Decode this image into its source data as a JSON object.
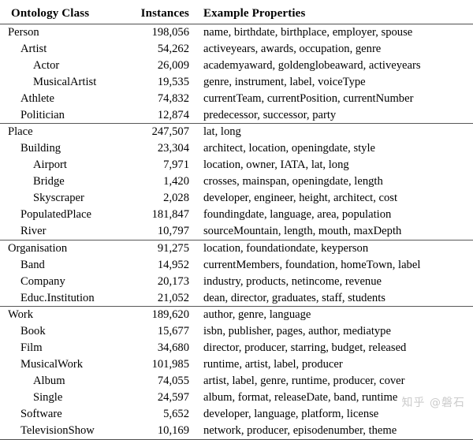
{
  "table": {
    "columns": [
      {
        "key": "ontology_class",
        "header": "Ontology Class",
        "align": "left"
      },
      {
        "key": "instances",
        "header": "Instances",
        "align": "right"
      },
      {
        "key": "example_properties",
        "header": "Example Properties",
        "align": "left"
      }
    ],
    "groups": [
      {
        "name": "Person",
        "rows": [
          {
            "level": 0,
            "ontology_class": "Person",
            "instances": "198,056",
            "example_properties": "name, birthdate, birthplace, employer, spouse"
          },
          {
            "level": 1,
            "ontology_class": "Artist",
            "instances": "54,262",
            "example_properties": "activeyears, awards, occupation, genre"
          },
          {
            "level": 2,
            "ontology_class": "Actor",
            "instances": "26,009",
            "example_properties": "academyaward, goldenglobeaward, activeyears"
          },
          {
            "level": 2,
            "ontology_class": "MusicalArtist",
            "instances": "19,535",
            "example_properties": "genre, instrument, label, voiceType"
          },
          {
            "level": 1,
            "ontology_class": "Athlete",
            "instances": "74,832",
            "example_properties": "currentTeam, currentPosition, currentNumber"
          },
          {
            "level": 1,
            "ontology_class": "Politician",
            "instances": "12,874",
            "example_properties": "predecessor, successor, party"
          }
        ]
      },
      {
        "name": "Place",
        "rows": [
          {
            "level": 0,
            "ontology_class": "Place",
            "instances": "247,507",
            "example_properties": "lat, long"
          },
          {
            "level": 1,
            "ontology_class": "Building",
            "instances": "23,304",
            "example_properties": "architect, location, openingdate, style"
          },
          {
            "level": 2,
            "ontology_class": "Airport",
            "instances": "7,971",
            "example_properties": "location, owner, IATA, lat, long"
          },
          {
            "level": 2,
            "ontology_class": "Bridge",
            "instances": "1,420",
            "example_properties": "crosses, mainspan, openingdate, length"
          },
          {
            "level": 2,
            "ontology_class": "Skyscraper",
            "instances": "2,028",
            "example_properties": "developer, engineer, height, architect, cost"
          },
          {
            "level": 1,
            "ontology_class": "PopulatedPlace",
            "instances": "181,847",
            "example_properties": "foundingdate, language, area, population"
          },
          {
            "level": 1,
            "ontology_class": "River",
            "instances": "10,797",
            "example_properties": "sourceMountain, length, mouth, maxDepth"
          }
        ]
      },
      {
        "name": "Organisation",
        "rows": [
          {
            "level": 0,
            "ontology_class": "Organisation",
            "instances": "91,275",
            "example_properties": "location, foundationdate, keyperson"
          },
          {
            "level": 1,
            "ontology_class": "Band",
            "instances": "14,952",
            "example_properties": "currentMembers, foundation, homeTown, label"
          },
          {
            "level": 1,
            "ontology_class": "Company",
            "instances": "20,173",
            "example_properties": "industry, products, netincome, revenue"
          },
          {
            "level": 1,
            "ontology_class": "Educ.Institution",
            "instances": "21,052",
            "example_properties": "dean, director, graduates, staff, students"
          }
        ]
      },
      {
        "name": "Work",
        "rows": [
          {
            "level": 0,
            "ontology_class": "Work",
            "instances": "189,620",
            "example_properties": "author, genre, language"
          },
          {
            "level": 1,
            "ontology_class": "Book",
            "instances": "15,677",
            "example_properties": "isbn, publisher, pages, author, mediatype"
          },
          {
            "level": 1,
            "ontology_class": "Film",
            "instances": "34,680",
            "example_properties": "director, producer, starring, budget, released"
          },
          {
            "level": 1,
            "ontology_class": "MusicalWork",
            "instances": "101,985",
            "example_properties": "runtime, artist, label, producer"
          },
          {
            "level": 2,
            "ontology_class": "Album",
            "instances": "74,055",
            "example_properties": "artist, label, genre, runtime, producer, cover"
          },
          {
            "level": 2,
            "ontology_class": "Single",
            "instances": "24,597",
            "example_properties": "album, format, releaseDate, band, runtime"
          },
          {
            "level": 1,
            "ontology_class": "Software",
            "instances": "5,652",
            "example_properties": "developer, language, platform, license"
          },
          {
            "level": 1,
            "ontology_class": "TelevisionShow",
            "instances": "10,169",
            "example_properties": "network, producer, episodenumber, theme"
          }
        ]
      }
    ]
  },
  "watermark": {
    "text": "知乎 @磐石"
  }
}
